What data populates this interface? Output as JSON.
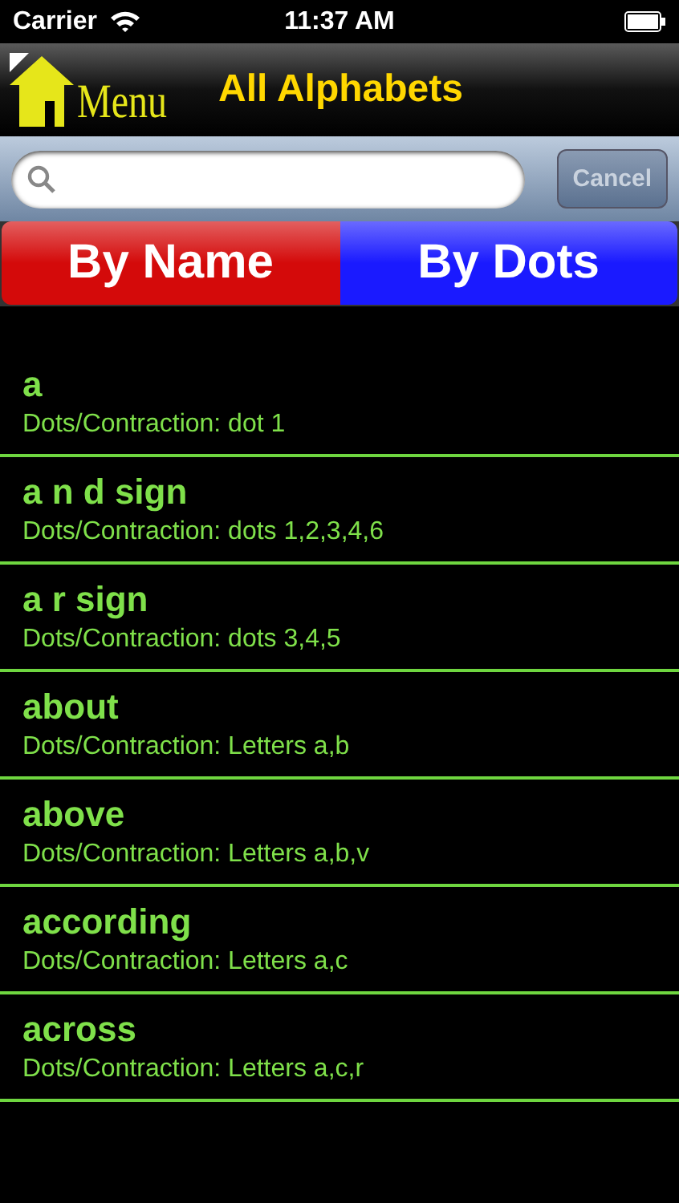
{
  "status_bar": {
    "carrier": "Carrier",
    "time": "11:37 AM"
  },
  "nav": {
    "menu_label": "Menu",
    "title": "All Alphabets"
  },
  "search": {
    "cancel": "Cancel"
  },
  "segments": [
    {
      "label": "By Name",
      "color": "#d40a0a"
    },
    {
      "label": "By Dots",
      "color": "#1a1aff"
    }
  ],
  "items": [
    {
      "name": "a",
      "detail": "Dots/Contraction: dot 1"
    },
    {
      "name": "a n d sign",
      "detail": "Dots/Contraction: dots 1,2,3,4,6"
    },
    {
      "name": "a r sign",
      "detail": "Dots/Contraction: dots 3,4,5"
    },
    {
      "name": "about",
      "detail": "Dots/Contraction: Letters a,b"
    },
    {
      "name": "above",
      "detail": "Dots/Contraction: Letters a,b,v"
    },
    {
      "name": "according",
      "detail": "Dots/Contraction: Letters a,c"
    },
    {
      "name": "across",
      "detail": "Dots/Contraction: Letters a,c,r"
    }
  ]
}
